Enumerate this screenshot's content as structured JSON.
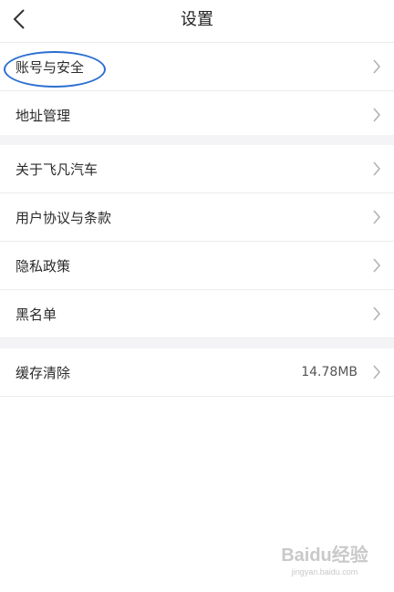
{
  "header": {
    "title": "设置",
    "back_icon": "chevron-left-icon"
  },
  "groups": [
    {
      "items": [
        {
          "label": "账号与安全"
        },
        {
          "label": "地址管理"
        }
      ]
    },
    {
      "items": [
        {
          "label": "关于飞凡汽车"
        },
        {
          "label": "用户协议与条款"
        },
        {
          "label": "隐私政策"
        },
        {
          "label": "黑名单"
        }
      ]
    },
    {
      "items": [
        {
          "label": "缓存清除",
          "value": "14.78MB"
        }
      ]
    }
  ],
  "annotation": {
    "color": "#2a6fd1"
  },
  "watermark": {
    "title": "Baidu经验",
    "subtitle": "jingyan.baidu.com"
  }
}
